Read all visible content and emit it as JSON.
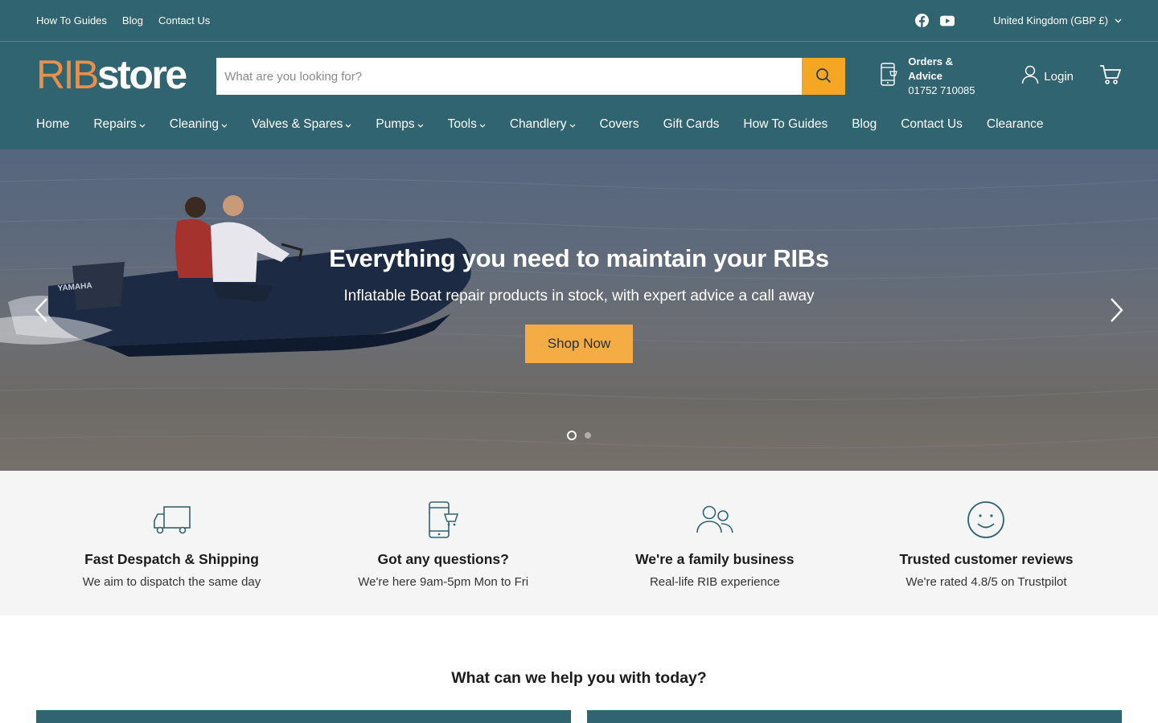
{
  "topbar": {
    "links": [
      "How To Guides",
      "Blog",
      "Contact Us"
    ],
    "social": [
      "facebook-icon",
      "youtube-icon"
    ],
    "currency": "United Kingdom (GBP £)"
  },
  "header": {
    "logo_part1": "RIB",
    "logo_part2": "store",
    "search_placeholder": "What are you looking for?",
    "orders_title": "Orders & Advice",
    "orders_phone": "01752 710085",
    "login_label": "Login"
  },
  "nav": {
    "items": [
      {
        "label": "Home",
        "dropdown": false
      },
      {
        "label": "Repairs",
        "dropdown": true
      },
      {
        "label": "Cleaning",
        "dropdown": true
      },
      {
        "label": "Valves & Spares",
        "dropdown": true
      },
      {
        "label": "Pumps",
        "dropdown": true
      },
      {
        "label": "Tools",
        "dropdown": true
      },
      {
        "label": "Chandlery",
        "dropdown": true
      },
      {
        "label": "Covers",
        "dropdown": false
      },
      {
        "label": "Gift Cards",
        "dropdown": false
      },
      {
        "label": "How To Guides",
        "dropdown": false
      },
      {
        "label": "Blog",
        "dropdown": false
      },
      {
        "label": "Contact Us",
        "dropdown": false
      },
      {
        "label": "Clearance",
        "dropdown": false
      }
    ]
  },
  "hero": {
    "title": "Everything you need to maintain your RIBs",
    "subtitle": "Inflatable Boat repair products in stock, with expert advice a call away",
    "button": "Shop Now",
    "slide_count": 2,
    "active_slide": 1
  },
  "features": [
    {
      "icon": "truck-icon",
      "title": "Fast Despatch & Shipping",
      "desc": "We aim to dispatch the same day"
    },
    {
      "icon": "phone-chat-icon",
      "title": "Got any questions?",
      "desc": "We're here 9am-5pm Mon to Fri"
    },
    {
      "icon": "people-icon",
      "title": "We're a family business",
      "desc": "Real-life RIB experience"
    },
    {
      "icon": "smiley-icon",
      "title": "Trusted customer reviews",
      "desc": "We're rated 4.8/5 on Trustpilot"
    }
  ],
  "help": {
    "title": "What can we help you with today?"
  },
  "colors": {
    "header_bg": "#2f6470",
    "accent": "#f5a623",
    "logo_rib": "#e98f4a"
  }
}
